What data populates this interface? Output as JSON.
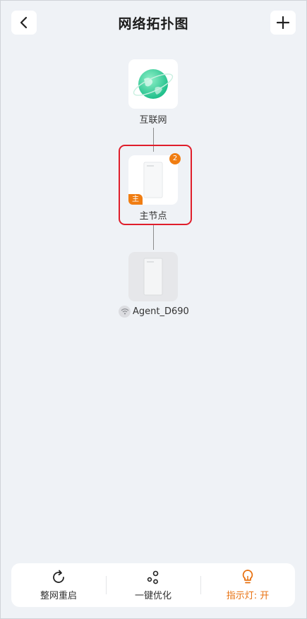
{
  "header": {
    "title": "网络拓扑图",
    "back_icon": "chevron-left-icon",
    "add_icon": "plus-icon"
  },
  "topology": {
    "internet": {
      "label": "互联网",
      "icon": "globe-icon"
    },
    "main_node": {
      "label": "主节点",
      "badge_count": "2",
      "tag": "主",
      "icon": "router-icon"
    },
    "agent_node": {
      "label": "Agent_D690",
      "status_icon": "wifi-icon",
      "icon": "router-icon"
    }
  },
  "actions": [
    {
      "label": "整网重启",
      "icon": "refresh-icon"
    },
    {
      "label": "一键优化",
      "icon": "optimize-icon"
    },
    {
      "label": "指示灯: 开",
      "icon": "lightbulb-icon"
    }
  ],
  "colors": {
    "accent": "#f07d12",
    "highlight": "#e01e2b",
    "background": "#eff2f6"
  }
}
